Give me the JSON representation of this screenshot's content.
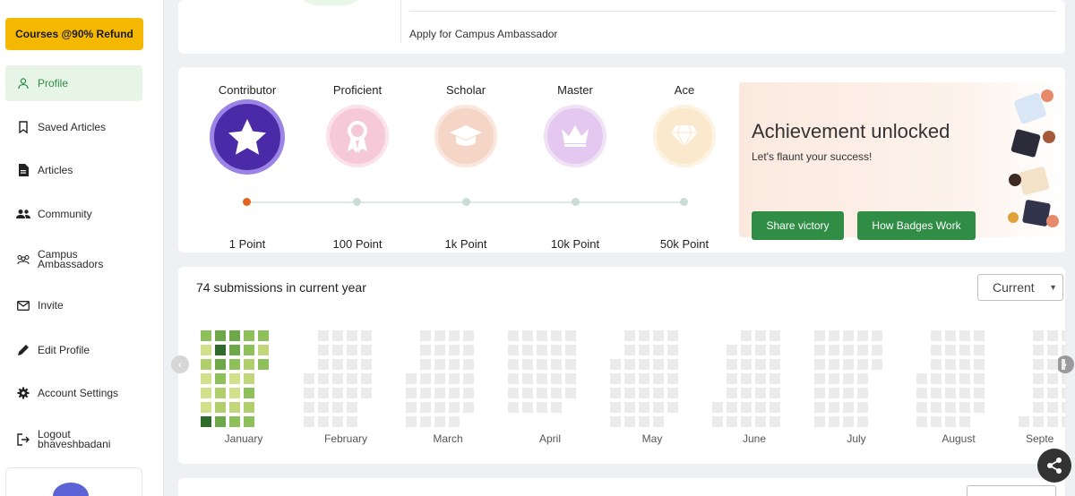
{
  "sidebar": {
    "courses_button": "Courses @90% Refund",
    "items": [
      {
        "label": "Profile",
        "icon": "user-icon",
        "active": true
      },
      {
        "label": "Saved Articles",
        "icon": "bookmark-icon",
        "active": false
      },
      {
        "label": "Articles",
        "icon": "document-icon",
        "active": false
      },
      {
        "label": "Community",
        "icon": "group-icon",
        "active": false
      },
      {
        "label": "Campus Ambassadors",
        "icon": "people-icon",
        "active": false
      },
      {
        "label": "Invite",
        "icon": "mail-icon",
        "active": false
      },
      {
        "label": "Edit Profile",
        "icon": "pencil-icon",
        "active": false
      },
      {
        "label": "Account Settings",
        "icon": "gear-icon",
        "active": false
      },
      {
        "label": "Logout bhaveshbadani",
        "icon": "logout-icon",
        "active": false
      }
    ]
  },
  "top_card": {
    "apply_link": "Apply for Campus Ambassador"
  },
  "badges": {
    "items": [
      {
        "name": "Contributor",
        "points": "1 Point",
        "icon": "star-icon",
        "achieved": true
      },
      {
        "name": "Proficient",
        "points": "100 Point",
        "icon": "ribbon-icon",
        "achieved": false
      },
      {
        "name": "Scholar",
        "points": "1k Point",
        "icon": "graduation-cap-icon",
        "achieved": false
      },
      {
        "name": "Master",
        "points": "10k Point",
        "icon": "crown-icon",
        "achieved": false
      },
      {
        "name": "Ace",
        "points": "50k Point",
        "icon": "diamond-icon",
        "achieved": false
      }
    ],
    "achievement": {
      "title": "Achievement unlocked",
      "subtitle": "Let's flaunt your success!",
      "share_button": "Share victory",
      "how_button": "How Badges Work"
    },
    "colors": {
      "contributor": "#4b2aa8",
      "proficient": "#f2c4d4",
      "scholar": "#f5d3c4",
      "master": "#e3c6ef",
      "ace": "#fbe7c8",
      "accent_green": "#2f8d46",
      "progress_dot_active": "#e0641f"
    }
  },
  "submissions": {
    "title": "74 submissions in current year",
    "select_value": "Current",
    "months": [
      "January",
      "February",
      "March",
      "April",
      "May",
      "June",
      "July",
      "August",
      "Septe"
    ]
  }
}
